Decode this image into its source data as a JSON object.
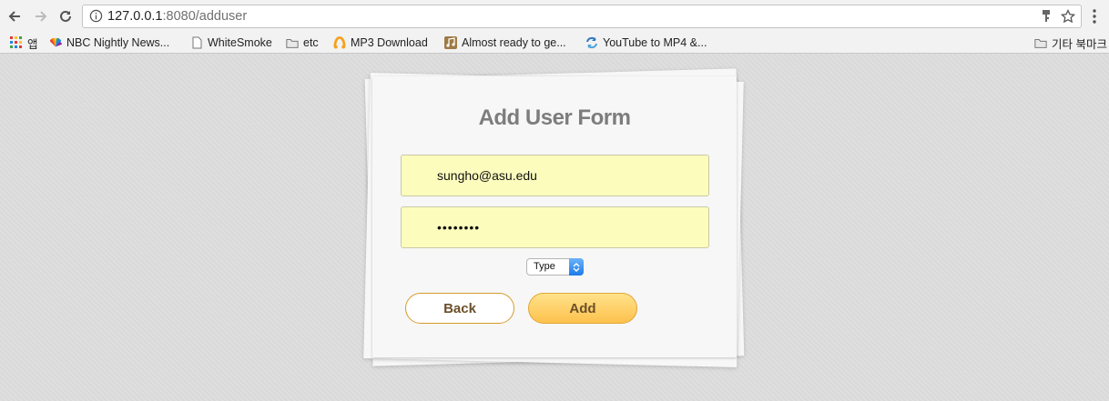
{
  "browser": {
    "url_host": "127.0.0.1",
    "url_rest": ":8080/adduser",
    "bookmarks": [
      {
        "label": "앱",
        "icon": "apps-grid-icon"
      },
      {
        "label": "NBC Nightly News...",
        "icon": "nbc-peacock-icon"
      },
      {
        "label": "WhiteSmoke",
        "icon": "page-icon"
      },
      {
        "label": "etc",
        "icon": "folder-icon"
      },
      {
        "label": "MP3 Download",
        "icon": "mp3-download-icon"
      },
      {
        "label": "Almost ready to ge...",
        "icon": "music-note-icon"
      },
      {
        "label": "YouTube to MP4 &...",
        "icon": "convert-arrows-icon"
      }
    ],
    "other_bookmarks": "기타 북마크"
  },
  "form": {
    "title": "Add User Form",
    "email_value": "sungho@asu.edu",
    "password_value": "••••••••",
    "type_select": "Type",
    "back_label": "Back",
    "add_label": "Add"
  },
  "colors": {
    "field_bg": "#fcfcbd",
    "add_button": "#fdc24d",
    "button_border": "#d79a2c",
    "select_arrow": "#1c7be9"
  }
}
